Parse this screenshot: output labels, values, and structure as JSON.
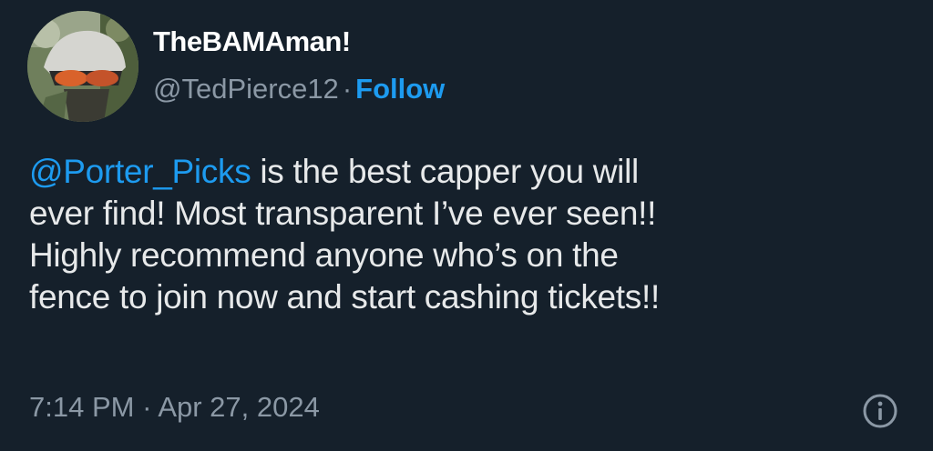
{
  "author": {
    "display_name": "TheBAMAman!",
    "handle": "@TedPierce12",
    "separator": "·",
    "follow_label": "Follow"
  },
  "tweet": {
    "mention": "@Porter_Picks",
    "line1_rest": " is the best capper you will",
    "line2": "ever find! Most transparent I’ve ever seen!!",
    "line3": "Highly recommend anyone who’s on the",
    "line4": "fence to join now and start cashing tickets!!"
  },
  "meta": {
    "time": "7:14 PM",
    "separator": "·",
    "date": "Apr 27, 2024"
  },
  "colors": {
    "background": "#15202b",
    "link_blue": "#1d9bf0",
    "secondary_text": "#8b98a5",
    "primary_text": "#e7e9ea"
  },
  "icons": {
    "info": "info-icon"
  }
}
